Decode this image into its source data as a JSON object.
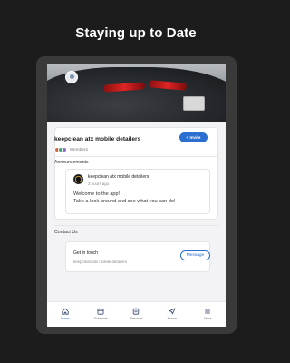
{
  "promo": {
    "title": "Staying up to Date"
  },
  "group": {
    "name": "keepclean atx mobile detailers",
    "members_label": "Members",
    "invite_label": "+ Invite"
  },
  "announcements": {
    "heading": "Announcements",
    "author": "keepclean atx mobile detailers",
    "time": "3 hours ago",
    "body": "Welcome to the app!\nTake a look around and see what you can do!"
  },
  "contact": {
    "heading": "Contact Us",
    "title": "Get in touch",
    "subtitle": "keepclean atx mobile detailers",
    "message_label": "Message"
  },
  "tabs": [
    {
      "label": "Home",
      "icon": "home-icon"
    },
    {
      "label": "Schedule",
      "icon": "calendar-icon"
    },
    {
      "label": "Services",
      "icon": "services-icon"
    },
    {
      "label": "Forum",
      "icon": "rocket-icon"
    },
    {
      "label": "More",
      "icon": "menu-icon"
    }
  ],
  "colors": {
    "accent": "#2b6fd1",
    "background": "#1c1c1c",
    "device": "#3a3a3a"
  }
}
